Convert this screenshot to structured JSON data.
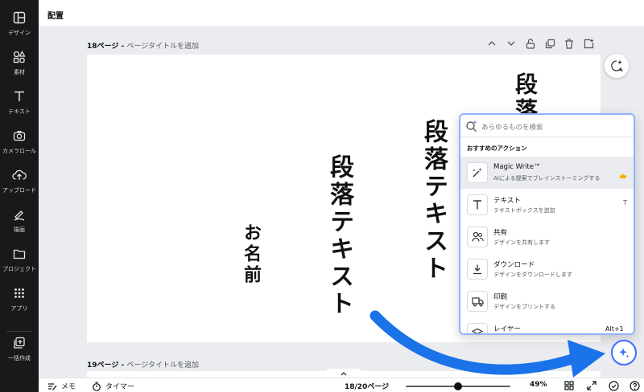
{
  "sidebar": {
    "items": [
      {
        "label": "デザイン",
        "icon": "layout-icon"
      },
      {
        "label": "素材",
        "icon": "elements-icon"
      },
      {
        "label": "テキスト",
        "icon": "text-icon"
      },
      {
        "label": "カメラロール",
        "icon": "camera-icon"
      },
      {
        "label": "アップロード",
        "icon": "upload-icon"
      },
      {
        "label": "描画",
        "icon": "draw-icon"
      },
      {
        "label": "プロジェクト",
        "icon": "folder-icon"
      },
      {
        "label": "アプリ",
        "icon": "apps-icon"
      },
      {
        "label": "一括作成",
        "icon": "bulk-create-icon"
      }
    ]
  },
  "header": {
    "title": "配置"
  },
  "page18": {
    "number": "18ページ",
    "separator": " - ",
    "title_placeholder": "ページタイトルを追加"
  },
  "page19": {
    "number": "19ページ",
    "separator": " - ",
    "title_placeholder": "ページタイトルを追加"
  },
  "canvas": {
    "text_top_right": "段落",
    "text_right": "段落テキスト",
    "text_center": "段落テキスト",
    "text_name": "お名前"
  },
  "panel": {
    "search_placeholder": "あらゆるものを検索",
    "section_title": "おすすめのアクション",
    "actions": [
      {
        "title": "Magic Write™",
        "desc": "AIによる提案でブレインストーミングする",
        "icon": "magic-write-icon"
      },
      {
        "title": "テキスト",
        "desc": "テキストボックスを追加",
        "icon": "text-icon",
        "shortcut": "T"
      },
      {
        "title": "共有",
        "desc": "デザインを共有します",
        "icon": "share-people-icon"
      },
      {
        "title": "ダウンロード",
        "desc": "デザインをダウンロードします",
        "icon": "download-icon"
      },
      {
        "title": "印刷",
        "desc": "デザインをプリントする",
        "icon": "print-truck-icon"
      },
      {
        "title": "レイヤー",
        "desc": "",
        "icon": "layers-icon"
      }
    ],
    "alt_hint": "Alt+1"
  },
  "bottombar": {
    "notes": "メモ",
    "timer": "タイマー",
    "page_counter": "18/20ページ",
    "zoom": "49%",
    "zoom_fraction": 0.49
  },
  "colors": {
    "accent": "#8b3dff",
    "arrow": "#1a73e8",
    "rail": "#18191b"
  }
}
